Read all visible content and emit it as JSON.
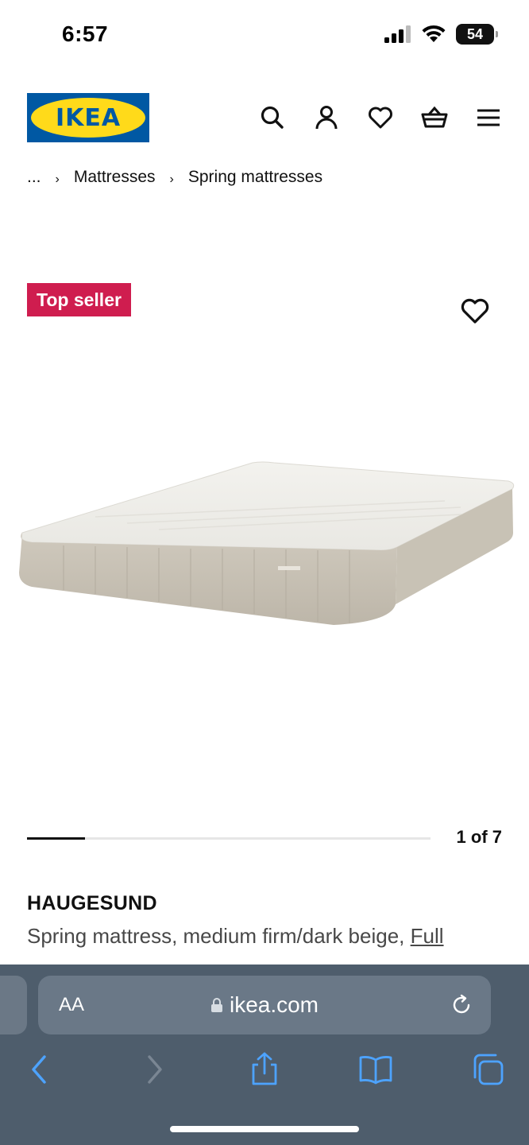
{
  "status": {
    "time": "6:57",
    "battery": "54"
  },
  "header": {
    "logo_text": "IKEA",
    "icons": [
      "search-icon",
      "user-icon",
      "heart-icon",
      "basket-icon",
      "menu-icon"
    ]
  },
  "breadcrumb": {
    "items": [
      "...",
      "Mattresses",
      "Spring mattresses"
    ]
  },
  "product": {
    "badge": "Top seller",
    "name": "HAUGESUND",
    "description": "Spring mattress, medium firm/dark beige, ",
    "size": "Full",
    "image_index": 1,
    "image_total": 7,
    "image_counter": "1 of 7"
  },
  "browser": {
    "aa": "AA",
    "url": "ikea.com"
  },
  "colors": {
    "ikea_blue": "#0058a3",
    "ikea_yellow": "#ffda1a",
    "badge_red": "#cf1d4f",
    "safari_bar": "#4e5d6c",
    "toolbar_blue": "#4da3ff"
  }
}
